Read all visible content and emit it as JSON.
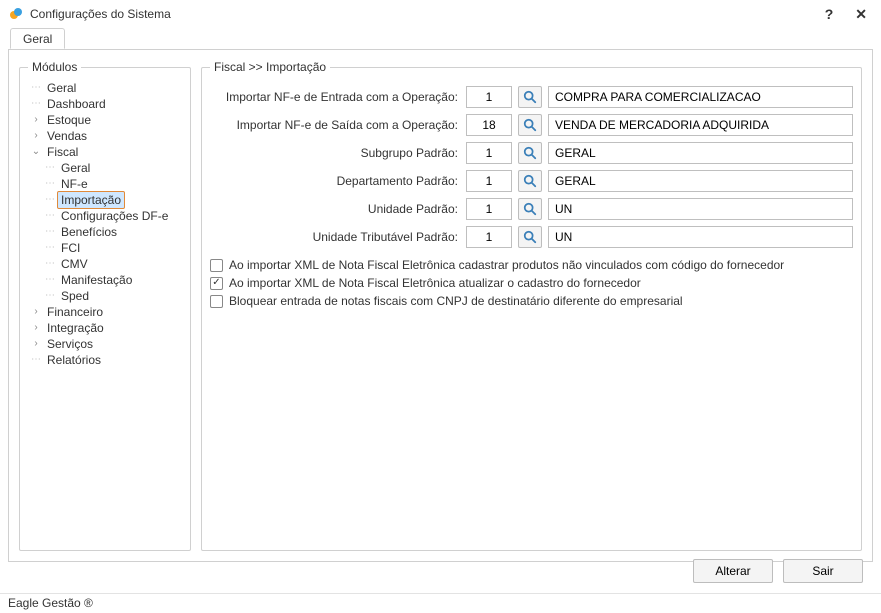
{
  "window": {
    "title": "Configurações do Sistema",
    "help_symbol": "?",
    "close_symbol": "✕"
  },
  "tab": {
    "label": "Geral"
  },
  "sidebar": {
    "legend": "Módulos",
    "items": [
      {
        "label": "Geral",
        "expanded": null
      },
      {
        "label": "Dashboard",
        "expanded": null
      },
      {
        "label": "Estoque",
        "expanded": false
      },
      {
        "label": "Vendas",
        "expanded": false
      },
      {
        "label": "Fiscal",
        "expanded": true,
        "children": [
          {
            "label": "Geral"
          },
          {
            "label": "NF-e"
          },
          {
            "label": "Importação",
            "selected": true
          },
          {
            "label": "Configurações DF-e"
          },
          {
            "label": "Benefícios"
          },
          {
            "label": "FCI"
          },
          {
            "label": "CMV"
          },
          {
            "label": "Manifestação"
          },
          {
            "label": "Sped"
          }
        ]
      },
      {
        "label": "Financeiro",
        "expanded": false
      },
      {
        "label": "Integração",
        "expanded": false
      },
      {
        "label": "Serviços",
        "expanded": false
      },
      {
        "label": "Relatórios",
        "expanded": null
      }
    ]
  },
  "content": {
    "legend": "Fiscal >> Importação",
    "rows": [
      {
        "label": "Importar NF-e de Entrada com a Operação:",
        "code": "1",
        "desc": "COMPRA PARA COMERCIALIZACAO"
      },
      {
        "label": "Importar NF-e de Saída com a Operação:",
        "code": "18",
        "desc": "VENDA DE MERCADORIA ADQUIRIDA"
      },
      {
        "label": "Subgrupo Padrão:",
        "code": "1",
        "desc": "GERAL"
      },
      {
        "label": "Departamento Padrão:",
        "code": "1",
        "desc": "GERAL"
      },
      {
        "label": "Unidade Padrão:",
        "code": "1",
        "desc": "UN"
      },
      {
        "label": "Unidade Tributável Padrão:",
        "code": "1",
        "desc": "UN"
      }
    ],
    "checks": [
      {
        "label": "Ao importar XML de Nota Fiscal Eletrônica cadastrar produtos não vinculados com código do fornecedor",
        "checked": false
      },
      {
        "label": "Ao importar XML de Nota Fiscal Eletrônica atualizar o cadastro do fornecedor",
        "checked": true
      },
      {
        "label": "Bloquear entrada de notas fiscais com CNPJ de destinatário diferente do empresarial",
        "checked": false
      }
    ]
  },
  "footer": {
    "alterar": "Alterar",
    "sair": "Sair"
  },
  "status": {
    "text": "Eagle Gestão ®"
  }
}
